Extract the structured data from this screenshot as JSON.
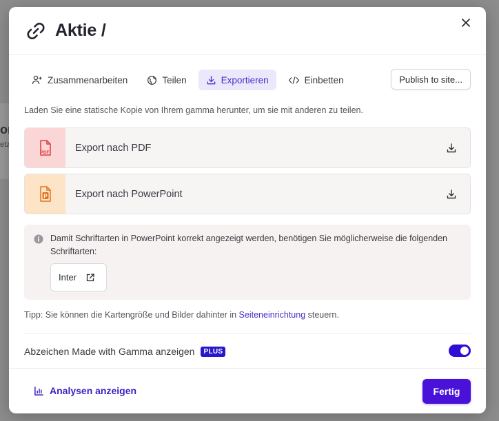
{
  "background": {
    "fragment_heading": "or",
    "fragment_sub": "etz"
  },
  "modal": {
    "title": "Aktie /",
    "title_icon": "link-icon",
    "close_icon": "close-icon"
  },
  "tabs": [
    {
      "label": "Zusammenarbeiten",
      "icon": "user-plus-icon",
      "active": false
    },
    {
      "label": "Teilen",
      "icon": "globe-icon",
      "active": false
    },
    {
      "label": "Exportieren",
      "icon": "download-icon",
      "active": true
    },
    {
      "label": "Einbetten",
      "icon": "code-icon",
      "active": false
    }
  ],
  "publish_button": "Publish to site...",
  "intro_text": "Laden Sie eine statische Kopie von Ihrem gamma herunter, um sie mit anderen zu teilen.",
  "exports": [
    {
      "label": "Export nach PDF",
      "icon": "pdf-file-icon",
      "icon_text": "PDF",
      "color": "#e03a3a"
    },
    {
      "label": "Export nach PowerPoint",
      "icon": "powerpoint-file-icon",
      "icon_text": "P",
      "color": "#e2731f"
    }
  ],
  "info": {
    "text": "Damit Schriftarten in PowerPoint korrekt angezeigt werden, benötigen Sie möglicherweise die folgenden Schriftarten:",
    "font_chip": "Inter"
  },
  "tip": {
    "prefix": "Tipp: Sie können die Kartengröße und Bilder dahinter in ",
    "link": "Seiteneinrichtung",
    "suffix": " steuern."
  },
  "badge_setting": {
    "label": "Abzeichen Made with Gamma anzeigen",
    "plan_badge": "PLUS",
    "enabled": true
  },
  "footer": {
    "analytics_label": "Analysen anzeigen",
    "done_label": "Fertig"
  },
  "colors": {
    "accent": "#4a12d9",
    "active_tab_bg": "#ebe8fb",
    "link": "#4a2fc7",
    "pdf_bg": "#fbd6d6",
    "ppt_bg": "#fde4c7"
  }
}
